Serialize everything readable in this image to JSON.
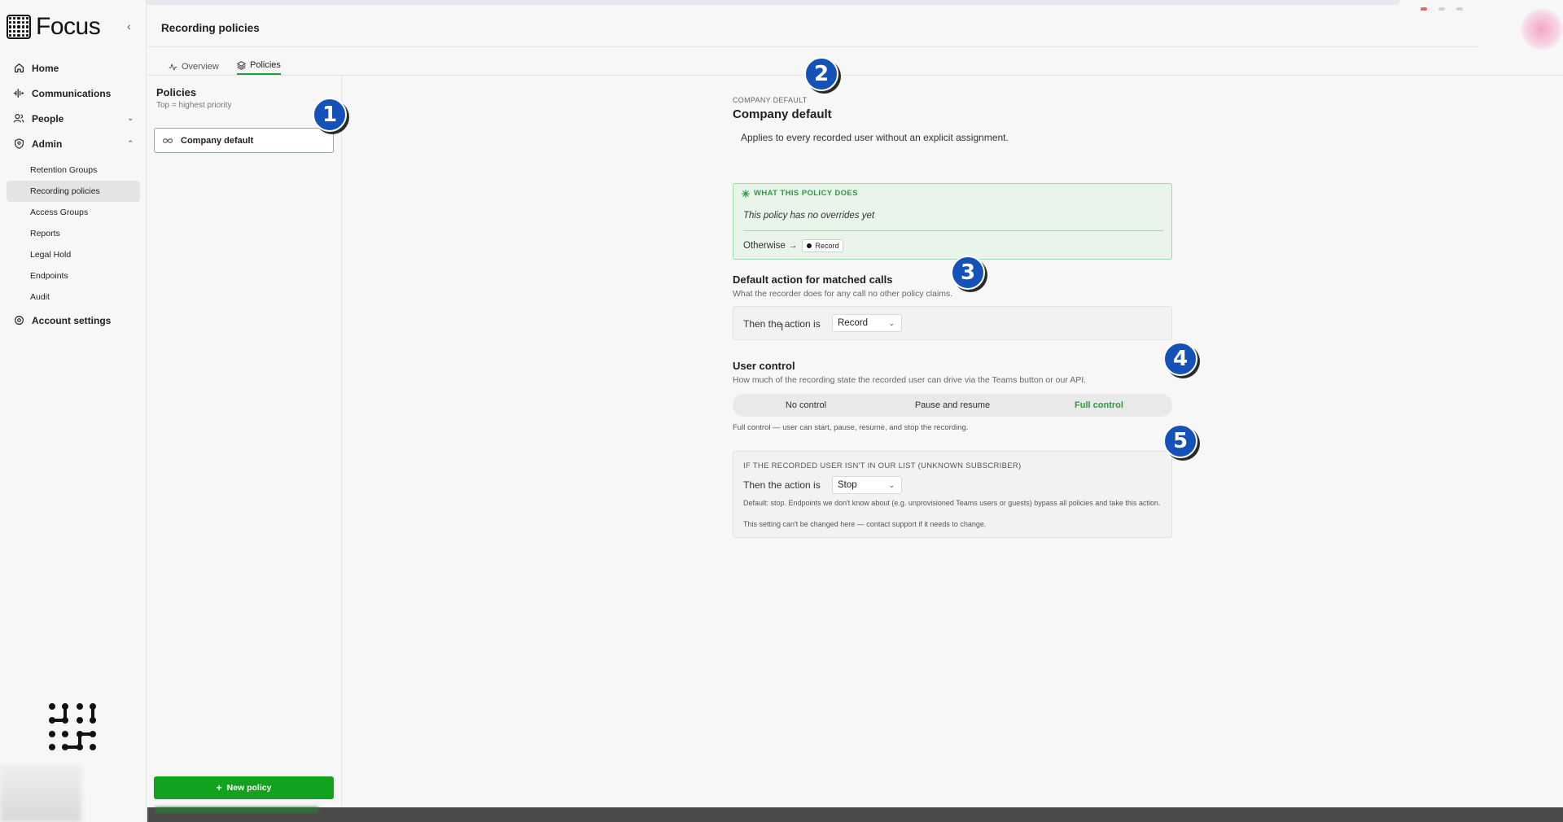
{
  "app": {
    "name": "Focus"
  },
  "sidebar": {
    "items": [
      {
        "label": "Home",
        "icon": "home-icon"
      },
      {
        "label": "Communications",
        "icon": "waveform-icon"
      },
      {
        "label": "People",
        "icon": "people-icon"
      },
      {
        "label": "Admin",
        "icon": "shield-icon"
      }
    ],
    "admin_sub": [
      {
        "label": "Retention Groups"
      },
      {
        "label": "Recording policies",
        "active": true
      },
      {
        "label": "Access Groups"
      },
      {
        "label": "Reports"
      },
      {
        "label": "Legal Hold"
      },
      {
        "label": "Endpoints"
      },
      {
        "label": "Audit"
      }
    ],
    "account": {
      "label": "Account settings",
      "icon": "gear-icon"
    }
  },
  "header": {
    "title": "Recording policies"
  },
  "tabs": [
    {
      "label": "Overview",
      "icon": "activity-icon"
    },
    {
      "label": "Policies",
      "icon": "layers-icon",
      "active": true
    }
  ],
  "policies_panel": {
    "title": "Policies",
    "hint": "Top = highest priority",
    "items": [
      {
        "label": "Company default",
        "icon": "infinity-icon"
      }
    ],
    "new_button": "New policy"
  },
  "detail": {
    "eyebrow": "COMPANY DEFAULT",
    "title": "Company default",
    "description": "Applies to every recorded user without an explicit assignment.",
    "what_it_does": {
      "heading": "WHAT THIS POLICY DOES",
      "none_text": "This policy has no overrides yet",
      "otherwise_label": "Otherwise →",
      "otherwise_value": "Record"
    },
    "default_action": {
      "title": "Default action for matched calls",
      "subtitle": "What the recorder does for any call no other policy claims.",
      "label": "Then the action is",
      "value": "Record"
    },
    "user_control": {
      "title": "User control",
      "subtitle": "How much of the recording state the recorded user can drive via the Teams button or our API.",
      "options": [
        "No control",
        "Pause and resume",
        "Full control"
      ],
      "selected": "Full control",
      "note": "Full control — user can start, pause, resume, and stop the recording."
    },
    "unknown": {
      "heading": "IF THE RECORDED USER ISN'T IN OUR LIST (UNKNOWN SUBSCRIBER)",
      "label": "Then the action is",
      "value": "Stop",
      "note1": "Default: stop. Endpoints we don't know about (e.g. unprovisioned Teams users or guests) bypass all policies and take this action.",
      "note2": "This setting can't be changed here — contact support if it needs to change."
    }
  },
  "markers": [
    "1",
    "2",
    "3",
    "4",
    "5"
  ],
  "colors": {
    "accent": "#13a21f",
    "marker": "#1552b8",
    "policy_bg": "#e9f5ea"
  }
}
